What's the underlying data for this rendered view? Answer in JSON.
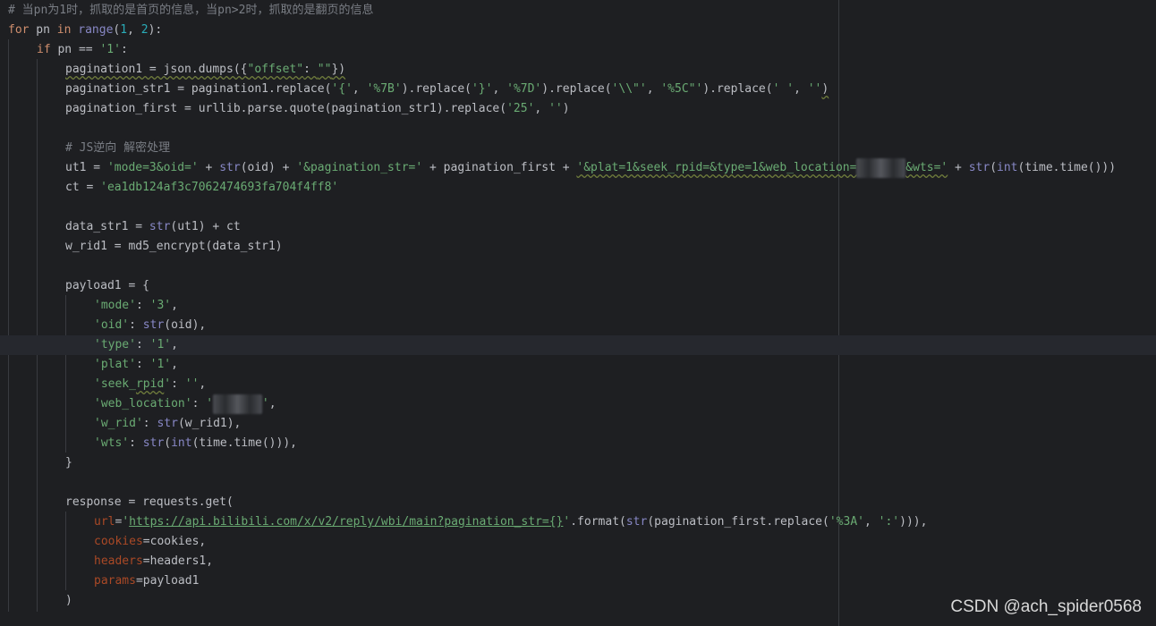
{
  "editor": {
    "lines": [
      {
        "indent": 0,
        "tokens": [
          {
            "t": "# 当pn为1时，抓取的是首页的信息，当pn>2时，抓取的是翻页的信息",
            "c": "cm"
          }
        ]
      },
      {
        "indent": 0,
        "tokens": [
          {
            "t": "for",
            "c": "kw"
          },
          {
            "t": " pn "
          },
          {
            "t": "in",
            "c": "kw"
          },
          {
            "t": " "
          },
          {
            "t": "range",
            "c": "bi"
          },
          {
            "t": "("
          },
          {
            "t": "1",
            "c": "num"
          },
          {
            "t": ", "
          },
          {
            "t": "2",
            "c": "num"
          },
          {
            "t": "):"
          }
        ]
      },
      {
        "indent": 1,
        "tokens": [
          {
            "t": "if",
            "c": "kw"
          },
          {
            "t": " pn == "
          },
          {
            "t": "'1'",
            "c": "str"
          },
          {
            "t": ":"
          }
        ]
      },
      {
        "indent": 2,
        "tokens": [
          {
            "t": "pagination1 = json.dumps({",
            "c": "wavy"
          },
          {
            "t": "\"offset\"",
            "c": "str wavy"
          },
          {
            "t": ": ",
            "c": "wavy"
          },
          {
            "t": "\"\"",
            "c": "str wavy"
          },
          {
            "t": "})",
            "c": "wavy"
          }
        ]
      },
      {
        "indent": 2,
        "tokens": [
          {
            "t": "pagination_str1 = pagination1.replace("
          },
          {
            "t": "'{'",
            "c": "str"
          },
          {
            "t": ", "
          },
          {
            "t": "'%7B'",
            "c": "str"
          },
          {
            "t": ").replace("
          },
          {
            "t": "'}'",
            "c": "str"
          },
          {
            "t": ", "
          },
          {
            "t": "'%7D'",
            "c": "str"
          },
          {
            "t": ").replace("
          },
          {
            "t": "'\\\\\"'",
            "c": "str"
          },
          {
            "t": ", "
          },
          {
            "t": "'%5C\"'",
            "c": "str"
          },
          {
            "t": ").replace("
          },
          {
            "t": "' '",
            "c": "str"
          },
          {
            "t": ", "
          },
          {
            "t": "''",
            "c": "str"
          },
          {
            "t": ")",
            "c": "wavy"
          }
        ]
      },
      {
        "indent": 2,
        "tokens": [
          {
            "t": "pagination_first = urllib.parse.quote(pagination_str1).replace("
          },
          {
            "t": "'25'",
            "c": "str"
          },
          {
            "t": ", "
          },
          {
            "t": "''",
            "c": "str"
          },
          {
            "t": ")"
          }
        ]
      },
      {
        "indent": 0,
        "tokens": []
      },
      {
        "indent": 2,
        "tokens": [
          {
            "t": "# JS逆向 解密处理",
            "c": "cm"
          }
        ]
      },
      {
        "indent": 2,
        "tokens": [
          {
            "t": "ut1 = "
          },
          {
            "t": "'mode=3&oid='",
            "c": "str"
          },
          {
            "t": " + "
          },
          {
            "t": "str",
            "c": "bi"
          },
          {
            "t": "(oid) + "
          },
          {
            "t": "'&pagination_str='",
            "c": "str"
          },
          {
            "t": " + pagination_first + "
          },
          {
            "t": "'&plat=1&seek_rpid=&type=1&web_location=",
            "c": "str wavy"
          },
          {
            "t": "1315875",
            "c": "redact"
          },
          {
            "t": "&wts='",
            "c": "str wavy"
          },
          {
            "t": " + "
          },
          {
            "t": "str",
            "c": "bi"
          },
          {
            "t": "("
          },
          {
            "t": "int",
            "c": "bi"
          },
          {
            "t": "(time.time()))"
          }
        ]
      },
      {
        "indent": 2,
        "tokens": [
          {
            "t": "ct = "
          },
          {
            "t": "'ea1db124af3c7062474693fa704f4ff8'",
            "c": "str"
          }
        ]
      },
      {
        "indent": 0,
        "tokens": []
      },
      {
        "indent": 2,
        "tokens": [
          {
            "t": "data_str1 = "
          },
          {
            "t": "str",
            "c": "bi"
          },
          {
            "t": "(ut1) + ct"
          }
        ]
      },
      {
        "indent": 2,
        "tokens": [
          {
            "t": "w_rid1 = md5_encrypt(data_str1)"
          }
        ]
      },
      {
        "indent": 0,
        "tokens": []
      },
      {
        "indent": 2,
        "tokens": [
          {
            "t": "payload1 = {"
          }
        ]
      },
      {
        "indent": 3,
        "tokens": [
          {
            "t": "'mode'",
            "c": "str"
          },
          {
            "t": ": "
          },
          {
            "t": "'3'",
            "c": "str"
          },
          {
            "t": ","
          }
        ]
      },
      {
        "indent": 3,
        "tokens": [
          {
            "t": "'oid'",
            "c": "str"
          },
          {
            "t": ": "
          },
          {
            "t": "str",
            "c": "bi"
          },
          {
            "t": "(oid),"
          }
        ]
      },
      {
        "indent": 3,
        "tokens": [
          {
            "t": "'type'",
            "c": "str"
          },
          {
            "t": ": "
          },
          {
            "t": "'1'",
            "c": "str"
          },
          {
            "t": ","
          }
        ]
      },
      {
        "indent": 3,
        "tokens": [
          {
            "t": "'plat'",
            "c": "str"
          },
          {
            "t": ": "
          },
          {
            "t": "'1'",
            "c": "str"
          },
          {
            "t": ","
          }
        ]
      },
      {
        "indent": 3,
        "tokens": [
          {
            "t": "'seek_",
            "c": "str"
          },
          {
            "t": "rpid",
            "c": "str wavy"
          },
          {
            "t": "'",
            "c": "str"
          },
          {
            "t": ": "
          },
          {
            "t": "''",
            "c": "str"
          },
          {
            "t": ","
          }
        ]
      },
      {
        "indent": 3,
        "tokens": [
          {
            "t": "'web_location'",
            "c": "str"
          },
          {
            "t": ": "
          },
          {
            "t": "'",
            "c": "str"
          },
          {
            "t": "1315875",
            "c": "redact"
          },
          {
            "t": "'",
            "c": "str"
          },
          {
            "t": ","
          }
        ]
      },
      {
        "indent": 3,
        "tokens": [
          {
            "t": "'w_rid'",
            "c": "str"
          },
          {
            "t": ": "
          },
          {
            "t": "str",
            "c": "bi"
          },
          {
            "t": "(w_rid1),"
          }
        ]
      },
      {
        "indent": 3,
        "tokens": [
          {
            "t": "'wts'",
            "c": "str"
          },
          {
            "t": ": "
          },
          {
            "t": "str",
            "c": "bi"
          },
          {
            "t": "("
          },
          {
            "t": "int",
            "c": "bi"
          },
          {
            "t": "(time.time())),"
          }
        ]
      },
      {
        "indent": 2,
        "tokens": [
          {
            "t": "}"
          }
        ]
      },
      {
        "indent": 0,
        "tokens": []
      },
      {
        "indent": 2,
        "tokens": [
          {
            "t": "response = requests.get("
          }
        ]
      },
      {
        "indent": 3,
        "tokens": [
          {
            "t": "url",
            "c": "kwarg"
          },
          {
            "t": "="
          },
          {
            "t": "'",
            "c": "str"
          },
          {
            "t": "https://api.bilibili.com/x/v2/reply/wbi/main?pagination_str={}",
            "c": "link"
          },
          {
            "t": "'",
            "c": "str"
          },
          {
            "t": ".format("
          },
          {
            "t": "str",
            "c": "bi"
          },
          {
            "t": "(pagination_first.replace("
          },
          {
            "t": "'%3A'",
            "c": "str"
          },
          {
            "t": ", "
          },
          {
            "t": "':'",
            "c": "str"
          },
          {
            "t": "))),"
          }
        ]
      },
      {
        "indent": 3,
        "tokens": [
          {
            "t": "cookies",
            "c": "kwarg"
          },
          {
            "t": "=cookies,"
          }
        ]
      },
      {
        "indent": 3,
        "tokens": [
          {
            "t": "headers",
            "c": "kwarg"
          },
          {
            "t": "=headers1,"
          }
        ]
      },
      {
        "indent": 3,
        "tokens": [
          {
            "t": "params",
            "c": "kwarg"
          },
          {
            "t": "=payload1"
          }
        ]
      },
      {
        "indent": 2,
        "tokens": [
          {
            "t": ")"
          }
        ]
      }
    ],
    "current_line": 17
  },
  "watermark": "CSDN @ach_spider0568"
}
